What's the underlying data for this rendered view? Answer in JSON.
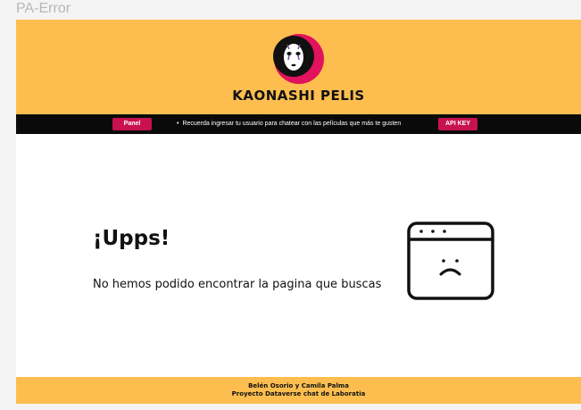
{
  "frame_label": "PA-Error",
  "header": {
    "brand": "KAONASHI PELIS",
    "logo_icon": "kaonashi-mask-icon",
    "background": "#fdbe4f"
  },
  "navbar": {
    "panel_button": "Panel",
    "marquee_bullet": "•",
    "marquee_text": "Recuerda ingresar  tu usuario para chatear con las películas que más te gusten",
    "api_key_button": "API KEY",
    "button_color": "#c8124f"
  },
  "error": {
    "title": "¡Upps!",
    "message": "No hemos podido encontrar la pagina que buscas",
    "icon": "sad-browser-window-icon"
  },
  "footer": {
    "authors": "Belén Osorio y Camila Palma",
    "project": "Proyecto Dataverse chat de Laboratia"
  }
}
